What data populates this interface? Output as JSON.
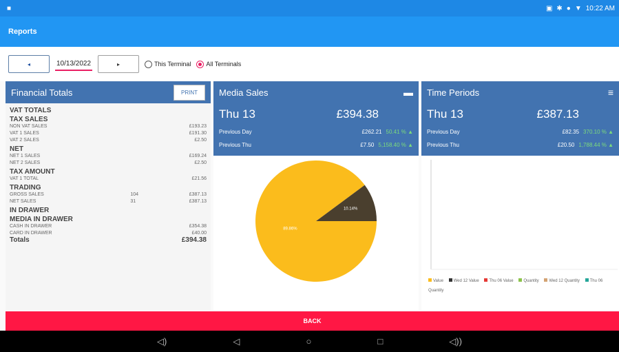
{
  "status": {
    "time": "10:22 AM"
  },
  "app": {
    "title": "Reports"
  },
  "toolbar": {
    "prev": "◂",
    "next": "▸",
    "date": "10/13/2022",
    "radio_this": "This Terminal",
    "radio_all": "All Terminals"
  },
  "financial": {
    "title": "Financial Totals",
    "print": "PRINT",
    "vat_totals": "VAT TOTALS",
    "tax_sales": "TAX SALES",
    "non_vat_label": "NON VAT SALES",
    "non_vat_val": "£193.23",
    "vat1_label": "VAT 1 SALES",
    "vat1_val": "£191.30",
    "vat2_label": "VAT 2 SALES",
    "vat2_val": "£2.50",
    "net": "NET",
    "net1_label": "NET 1 SALES",
    "net1_val": "£169.24",
    "net2_label": "NET 2 SALES",
    "net2_val": "£2.50",
    "tax_amount": "TAX AMOUNT",
    "vat1_total_label": "VAT 1 TOTAL",
    "vat1_total_val": "£21.56",
    "trading": "TRADING",
    "gross_label": "GROSS SALES",
    "gross_count": "104",
    "gross_val": "£387.13",
    "netsales_label": "NET SALES",
    "netsales_count": "31",
    "netsales_val": "£387.13",
    "in_drawer": "IN DRAWER",
    "media_in_drawer": "MEDIA IN DRAWER",
    "cash_label": "CASH IN DRAWER",
    "cash_val": "£354.38",
    "card_label": "CARD IN DRAWER",
    "card_val": "£40.00",
    "totals_label": "Totals",
    "totals_val": "£394.38"
  },
  "media": {
    "title": "Media Sales",
    "day": "Thu 13",
    "amount": "£394.38",
    "prev_day_label": "Previous Day",
    "prev_day_val": "£262.21",
    "prev_day_pct": "50.41 % ▲",
    "prev_thu_label": "Previous Thu",
    "prev_thu_val": "£7.50",
    "prev_thu_pct": "5,158.40 % ▲",
    "slice_large_label": "89.86%",
    "slice_small_label": "10.14%"
  },
  "time": {
    "title": "Time Periods",
    "day": "Thu 13",
    "amount": "£387.13",
    "prev_day_label": "Previous Day",
    "prev_day_val": "£82.35",
    "prev_day_pct": "370.10 % ▲",
    "prev_thu_label": "Previous Thu",
    "prev_thu_val": "£20.50",
    "prev_thu_pct": "1,788.44 % ▲",
    "legend": [
      "Value",
      "Wed 12 Value",
      "Thu 06 Value",
      "Quantity",
      "Wed 12 Quantity",
      "Thu 06 Quantity"
    ]
  },
  "back": "BACK",
  "colors": {
    "primary": "#2196f3",
    "panel": "#4273b0",
    "back": "#ff1744",
    "pie_large": "#fbbc1c",
    "pie_small": "#4a3f2e"
  },
  "chart_data": {
    "type": "pie",
    "labels": [
      "89.86%",
      "10.14%"
    ],
    "values": [
      89.86,
      10.14
    ]
  }
}
